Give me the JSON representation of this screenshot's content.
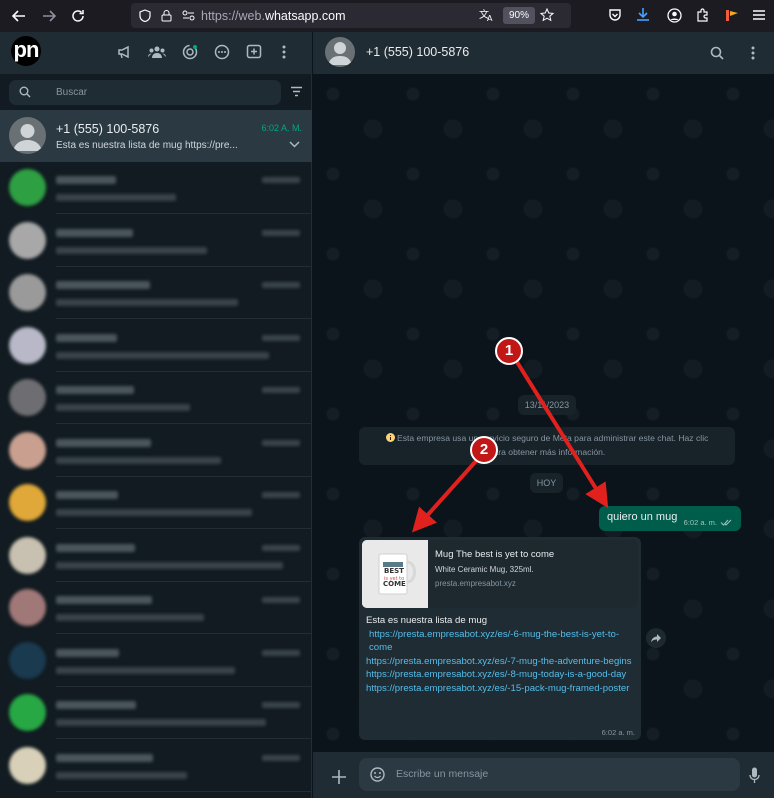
{
  "browser": {
    "url_scheme": "https://web.",
    "url_domain": "whatsapp.com",
    "zoom": "90%"
  },
  "sidebar": {
    "logo": "pn",
    "search_placeholder": "Buscar",
    "active_chat": {
      "name": "+1 (555) 100-5876",
      "time": "6:02 A. M.",
      "preview": "Esta es nuestra lista de mug      https://pre..."
    }
  },
  "conversation": {
    "contact": "+1 (555) 100-5876",
    "date_pill": "13/11/2023",
    "system_message_line1": "Esta empresa usa un servicio seguro de Meta para administrar este chat. Haz clic",
    "system_message_line2": "para obtener más información.",
    "today_pill": "HOY",
    "outgoing": {
      "text": "quiero un mug",
      "time": "6:02 a. m."
    },
    "incoming": {
      "card_title": "Mug The best is yet to come",
      "card_desc": "White Ceramic Mug, 325ml.",
      "card_domain": "presta.empresabot.xyz",
      "intro": "Esta es nuestra lista de mug",
      "links": [
        "https://presta.empresabot.xyz/es/-6-mug-the-best-is-yet-to-come",
        "https://presta.empresabot.xyz/es/-7-mug-the-adventure-begins",
        "https://presta.empresabot.xyz/es/-8-mug-today-is-a-good-day",
        "https://presta.empresabot.xyz/es/-15-pack-mug-framed-poster"
      ],
      "time": "6:02 a. m."
    },
    "composer_placeholder": "Escribe un mensaje"
  },
  "annotations": {
    "badge_1": "1",
    "badge_2": "2",
    "color": "#e0211e"
  },
  "colors": {
    "accent": "#00a884",
    "outgoing_bubble": "#005c4b",
    "incoming_bubble": "#202c33",
    "link": "#53bdeb"
  }
}
